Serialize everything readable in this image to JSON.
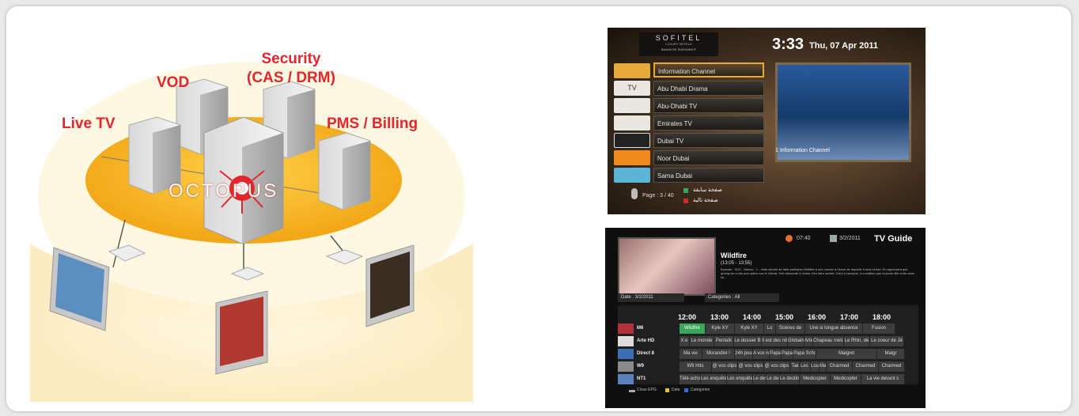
{
  "diagram": {
    "labels": {
      "live_tv": "Live TV",
      "vod": "VOD",
      "security_line1": "Security",
      "security_line2": "(CAS / DRM)",
      "pms_billing": "PMS / Billing"
    },
    "brand": "OCTOPUS",
    "colors": {
      "label_red": "#e3262b",
      "disc_orange": "#f7b21c"
    }
  },
  "hotel_menu": {
    "brand": "SOFITEL",
    "brand_sub": "LUXURY HOTELS",
    "brand_location": "BANGKOK SUKHUMVIT",
    "clock": "3:33",
    "date": "Thu, 07 Apr 2011",
    "channels": [
      "Information Channel",
      "Abu Dhabi Drama",
      "Abu-Dhabi TV",
      "Emirates TV",
      "Dubai TV",
      "Noor Dubai",
      "Sama Dubai"
    ],
    "channel_logos": [
      "",
      "TV",
      "",
      "",
      "",
      "",
      ""
    ],
    "page_indicator": "Page : 3 / 40",
    "prev_page": "صفحة سابقة",
    "next_page": "صفحة تالية",
    "preview_caption": "1 Information Channel"
  },
  "tv_guide": {
    "clock": "07:40",
    "date": "3/2/2011",
    "title": "TV Guide",
    "program_title": "Wildfire",
    "program_time": "(13:05 - 13:55)",
    "program_desc": "Episode : 3/12 - Saison : 1 - Jean décide de faire participer Wildfire à une course à l'issue de laquelle il sera vendu. En apprenant que quelqu'un a mis une option sur le cheval, Kris demande à Junior d'en faire autant. Celui-ci accepte, à condition que la jeune fille sorte avec lui...",
    "date_label": "Date : 3/2/2011",
    "categories_label": "Categories : All",
    "times": [
      "12:00",
      "13:00",
      "14:00",
      "15:00",
      "16:00",
      "17:00",
      "18:00"
    ],
    "rows": [
      {
        "channel": "M6",
        "cells": [
          "Wildfire",
          "Kyle XY",
          "Kyle XY",
          "Lo",
          "Scènes de",
          "Une si longue absence",
          "Fusion"
        ]
      },
      {
        "channel": "Arte HD",
        "cells": [
          "X:e",
          "Le monde",
          "Pentaïk",
          "Le dossier B",
          "Il est des nôtr",
          "Globalm",
          "Arte",
          "Chapeau melon",
          "Le Rhin, de",
          "Le coeur de Jé"
        ]
      },
      {
        "channel": "Direct 8",
        "cells": [
          "Ma vie",
          "Morandini !",
          "24h pour",
          "A vos re",
          "Papa",
          "Papa",
          "Papa Scho",
          "Maigret",
          "Maigr"
        ]
      },
      {
        "channel": "W9",
        "cells": [
          "W9 Hits",
          "@ vos clips",
          "@ vos clips",
          "@ vos clips",
          "Tak",
          "Les S",
          "Lou",
          "Ma",
          "Charmed",
          "Charmed",
          "Charmed"
        ]
      },
      {
        "channel": "NT1",
        "cells": [
          "Télé-achs",
          "Les enquêtes",
          "Les enquêtes",
          "Le dest",
          "Le dest",
          "Le destin",
          "Medicopter",
          "Medicopter",
          "La vie devant s"
        ]
      }
    ],
    "footer": {
      "close": "Close EPG",
      "date": "Date",
      "categories": "Categories"
    }
  }
}
